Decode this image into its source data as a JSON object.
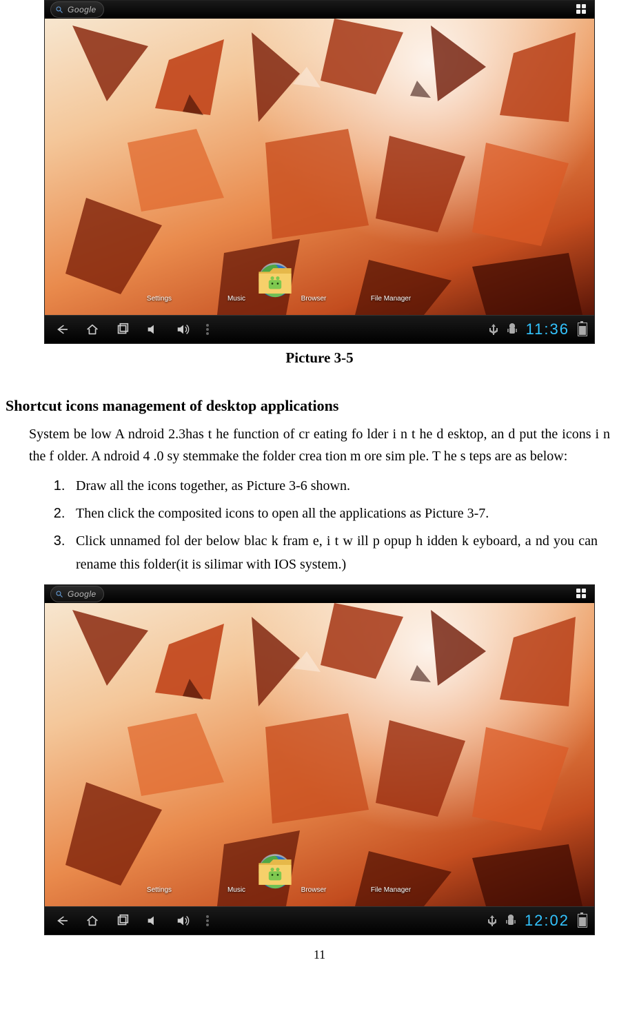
{
  "page_number": "11",
  "caption1": "Picture 3-5",
  "heading": "Shortcut icons management of desktop applications",
  "intro": "System be low A ndroid 2.3has t he function of cr eating fo lder i n t he d esktop, an d put the icons i n the f older. A ndroid 4 .0 sy stemmake the folder crea tion m ore sim ple. T he s teps are as below:",
  "steps": [
    "Draw all the icons together, as Picture 3-6 shown.",
    "Then click the composited icons to open all the applications as Picture 3-7.",
    "Click unnamed fol der below blac k fram e, i t w ill p opup h idden k eyboard, a nd you can rename this folder(it is silimar with IOS system.)"
  ],
  "screenshot1": {
    "search_label": "Google",
    "apps": [
      {
        "name": "settings",
        "label": "Settings"
      },
      {
        "name": "music",
        "label": "Music"
      },
      {
        "name": "browser",
        "label": "Browser"
      },
      {
        "name": "filemanager",
        "label": "File Manager"
      }
    ],
    "clock": "11:36"
  },
  "screenshot2": {
    "search_label": "Google",
    "apps": [
      {
        "name": "settings",
        "label": "Settings"
      },
      {
        "name": "music",
        "label": "Music"
      },
      {
        "name": "browser",
        "label": "Browser"
      },
      {
        "name": "filemanager",
        "label": "File Manager"
      }
    ],
    "clock": "12:02"
  }
}
